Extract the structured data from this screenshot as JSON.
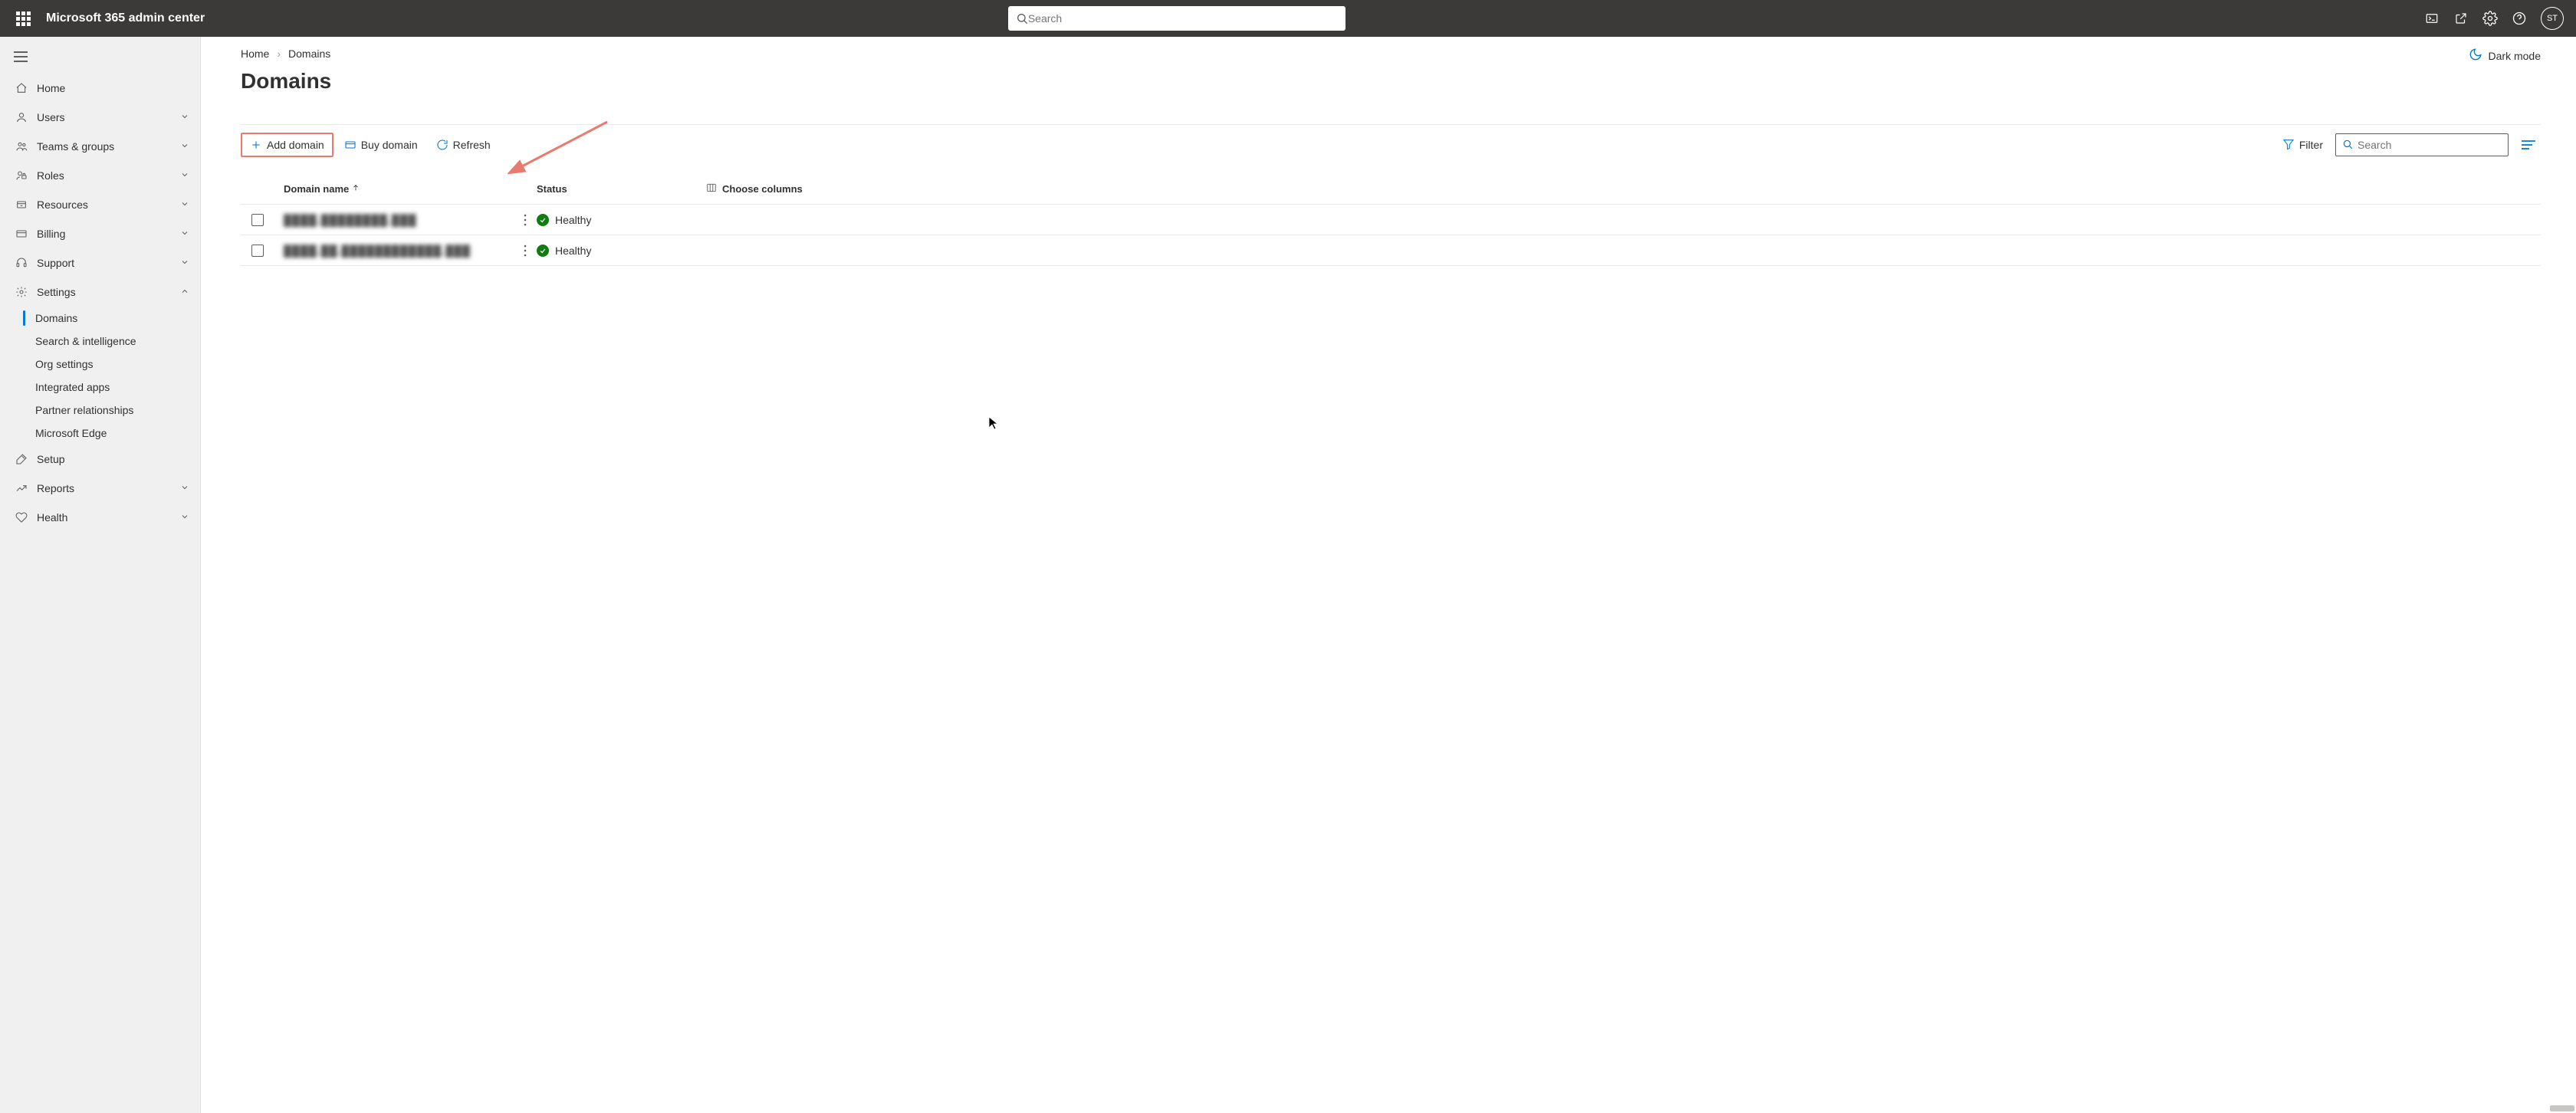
{
  "header": {
    "app_title": "Microsoft 365 admin center",
    "search_placeholder": "Search",
    "avatar_initials": "ST"
  },
  "sidebar": {
    "items": [
      {
        "icon": "home",
        "label": "Home",
        "expandable": false
      },
      {
        "icon": "user",
        "label": "Users",
        "expandable": true
      },
      {
        "icon": "group",
        "label": "Teams & groups",
        "expandable": true
      },
      {
        "icon": "roles",
        "label": "Roles",
        "expandable": true
      },
      {
        "icon": "resources",
        "label": "Resources",
        "expandable": true
      },
      {
        "icon": "billing",
        "label": "Billing",
        "expandable": true
      },
      {
        "icon": "support",
        "label": "Support",
        "expandable": true
      },
      {
        "icon": "settings",
        "label": "Settings",
        "expandable": true,
        "expanded": true,
        "children": [
          {
            "label": "Domains",
            "active": true
          },
          {
            "label": "Search & intelligence"
          },
          {
            "label": "Org settings"
          },
          {
            "label": "Integrated apps"
          },
          {
            "label": "Partner relationships"
          },
          {
            "label": "Microsoft Edge"
          }
        ]
      },
      {
        "icon": "setup",
        "label": "Setup",
        "expandable": false
      },
      {
        "icon": "reports",
        "label": "Reports",
        "expandable": true
      },
      {
        "icon": "health",
        "label": "Health",
        "expandable": true
      }
    ]
  },
  "breadcrumb": {
    "root": "Home",
    "current": "Domains"
  },
  "page": {
    "title": "Domains",
    "dark_mode_label": "Dark mode"
  },
  "commands": {
    "add_domain": "Add domain",
    "buy_domain": "Buy domain",
    "refresh": "Refresh",
    "filter": "Filter",
    "search_placeholder": "Search",
    "choose_columns": "Choose columns"
  },
  "table": {
    "col_domain": "Domain name",
    "col_status": "Status",
    "rows": [
      {
        "domain": "████.████████.███",
        "status": "Healthy"
      },
      {
        "domain": "████.██.████████████.███",
        "status": "Healthy"
      }
    ]
  }
}
